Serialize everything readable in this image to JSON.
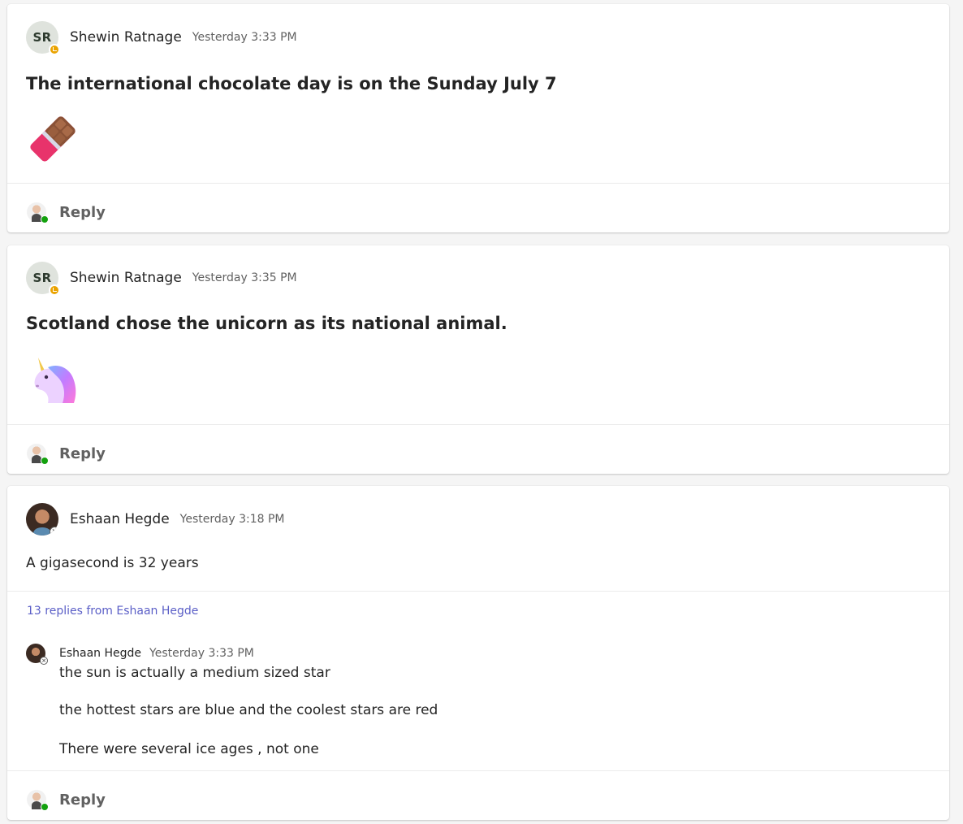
{
  "posts": [
    {
      "avatar_initials": "SR",
      "author": "Shewin Ratnage",
      "timestamp": "Yesterday 3:33 PM",
      "presence": "away",
      "title": "The international chocolate day is on the Sunday July 7",
      "emoji": "chocolate-bar-icon",
      "reply_label": "Reply"
    },
    {
      "avatar_initials": "SR",
      "author": "Shewin Ratnage",
      "timestamp": "Yesterday 3:35 PM",
      "presence": "away",
      "title": "Scotland chose the unicorn as its national animal.",
      "emoji": "unicorn-icon",
      "reply_label": "Reply"
    },
    {
      "author": "Eshaan Hegde",
      "timestamp": "Yesterday 3:18 PM",
      "presence": "offline",
      "text": "A gigasecond is 32 years",
      "thread_link": "13 replies from Eshaan Hegde",
      "reply": {
        "author": "Eshaan Hegde",
        "timestamp": "Yesterday 3:33 PM",
        "lines": [
          "the sun is actually a medium sized star",
          "the hottest stars are blue and the coolest stars are red",
          "There were several ice ages , not one"
        ]
      },
      "reply_label": "Reply"
    }
  ],
  "colors": {
    "accent": "#5b5fc7",
    "away": "#eaa300",
    "available": "#13a10e"
  }
}
